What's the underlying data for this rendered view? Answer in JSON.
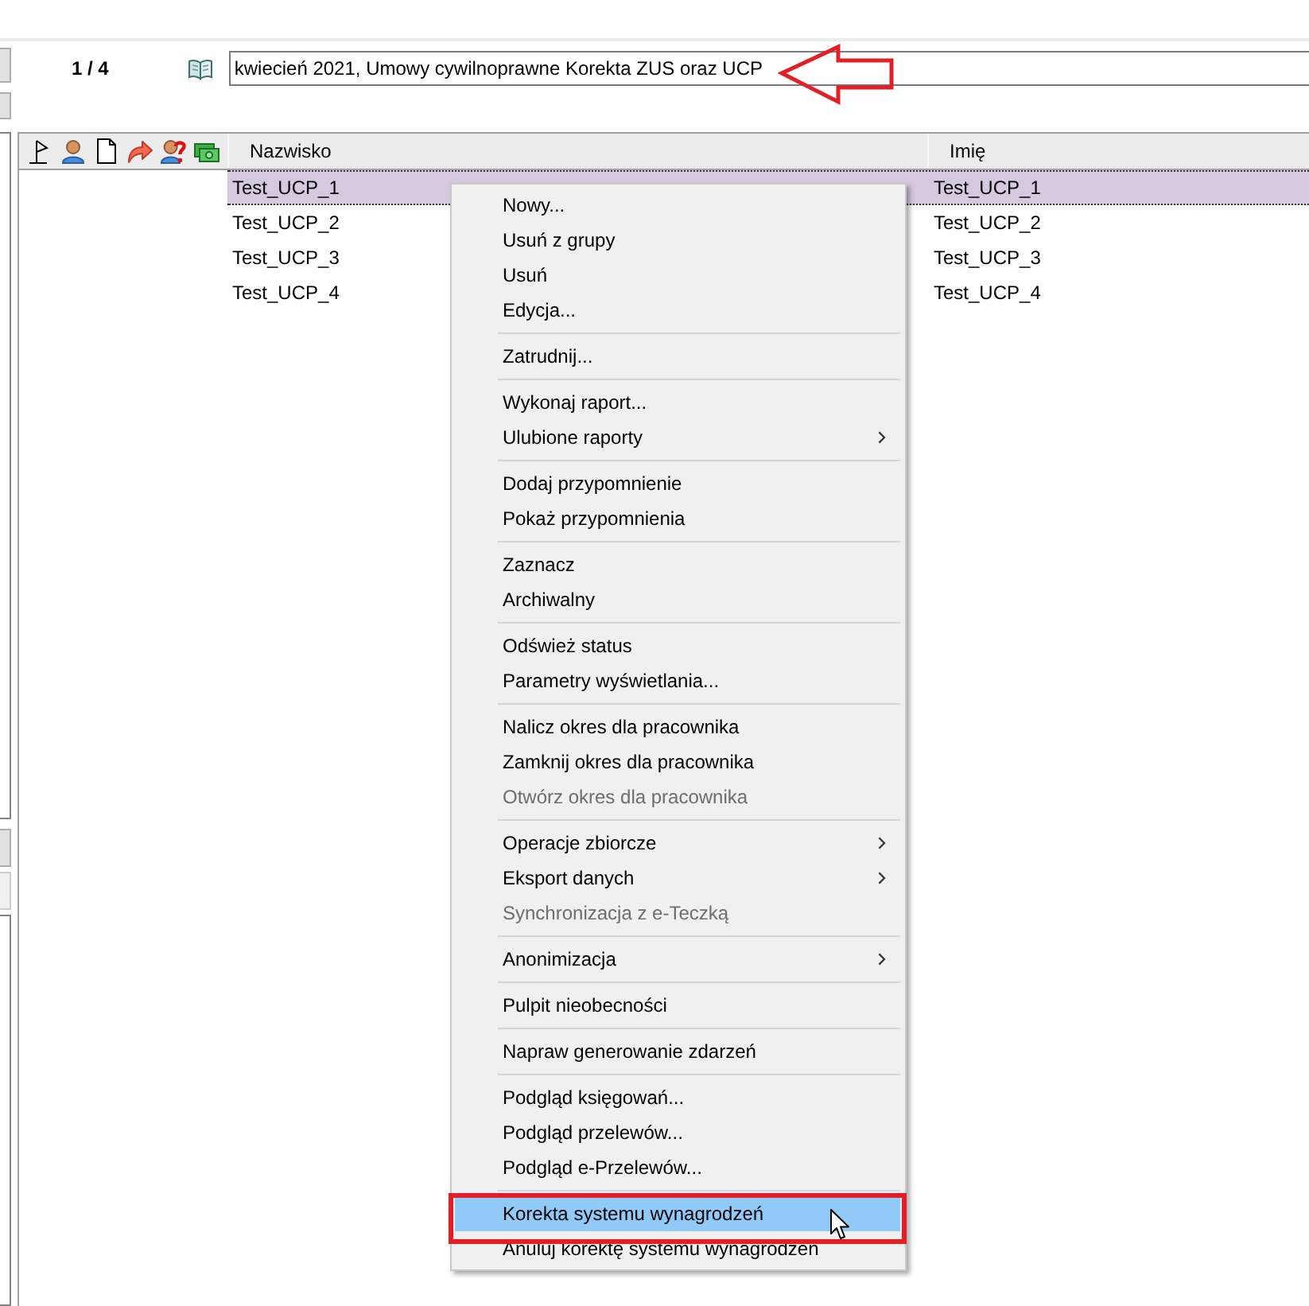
{
  "toolbar": {
    "record_counter": "1 / 4",
    "period_field": {
      "value": "kwiecień 2021, Umowy cywilnoprawne Korekta ZUS oraz UCP"
    }
  },
  "table": {
    "columns": [
      "Nazwisko",
      "Imię"
    ],
    "rows": [
      {
        "cells": [
          "Test_UCP_1",
          "Test_UCP_1"
        ],
        "selected": true
      },
      {
        "cells": [
          "Test_UCP_2",
          "Test_UCP_2"
        ],
        "selected": false
      },
      {
        "cells": [
          "Test_UCP_3",
          "Test_UCP_3"
        ],
        "selected": false
      },
      {
        "cells": [
          "Test_UCP_4",
          "Test_UCP_4"
        ],
        "selected": false
      }
    ]
  },
  "context_menu": {
    "groups": [
      {
        "items": [
          {
            "label": "Nowy...",
            "disabled": false,
            "submenu": false,
            "selected": false
          },
          {
            "label": "Usuń z grupy",
            "disabled": false,
            "submenu": false,
            "selected": false
          },
          {
            "label": "Usuń",
            "disabled": false,
            "submenu": false,
            "selected": false
          },
          {
            "label": "Edycja...",
            "disabled": false,
            "submenu": false,
            "selected": false
          }
        ]
      },
      {
        "items": [
          {
            "label": "Zatrudnij...",
            "disabled": false,
            "submenu": false,
            "selected": false
          }
        ]
      },
      {
        "items": [
          {
            "label": "Wykonaj raport...",
            "disabled": false,
            "submenu": false,
            "selected": false
          },
          {
            "label": "Ulubione raporty",
            "disabled": false,
            "submenu": true,
            "selected": false
          }
        ]
      },
      {
        "items": [
          {
            "label": "Dodaj przypomnienie",
            "disabled": false,
            "submenu": false,
            "selected": false
          },
          {
            "label": "Pokaż przypomnienia",
            "disabled": false,
            "submenu": false,
            "selected": false
          }
        ]
      },
      {
        "items": [
          {
            "label": "Zaznacz",
            "disabled": false,
            "submenu": false,
            "selected": false
          },
          {
            "label": "Archiwalny",
            "disabled": false,
            "submenu": false,
            "selected": false
          }
        ]
      },
      {
        "items": [
          {
            "label": "Odśwież status",
            "disabled": false,
            "submenu": false,
            "selected": false
          },
          {
            "label": "Parametry wyświetlania...",
            "disabled": false,
            "submenu": false,
            "selected": false
          }
        ]
      },
      {
        "items": [
          {
            "label": "Nalicz okres dla pracownika",
            "disabled": false,
            "submenu": false,
            "selected": false
          },
          {
            "label": "Zamknij okres dla pracownika",
            "disabled": false,
            "submenu": false,
            "selected": false
          },
          {
            "label": "Otwórz okres dla pracownika",
            "disabled": true,
            "submenu": false,
            "selected": false
          }
        ]
      },
      {
        "items": [
          {
            "label": "Operacje zbiorcze",
            "disabled": false,
            "submenu": true,
            "selected": false
          },
          {
            "label": "Eksport danych",
            "disabled": false,
            "submenu": true,
            "selected": false
          },
          {
            "label": "Synchronizacja z e-Teczką",
            "disabled": true,
            "submenu": false,
            "selected": false
          }
        ]
      },
      {
        "items": [
          {
            "label": "Anonimizacja",
            "disabled": false,
            "submenu": true,
            "selected": false
          }
        ]
      },
      {
        "items": [
          {
            "label": "Pulpit nieobecności",
            "disabled": false,
            "submenu": false,
            "selected": false
          }
        ]
      },
      {
        "items": [
          {
            "label": "Napraw generowanie zdarzeń",
            "disabled": false,
            "submenu": false,
            "selected": false
          }
        ]
      },
      {
        "items": [
          {
            "label": "Podgląd księgowań...",
            "disabled": false,
            "submenu": false,
            "selected": false
          },
          {
            "label": "Podgląd przelewów...",
            "disabled": false,
            "submenu": false,
            "selected": false
          },
          {
            "label": "Podgląd e-Przelewów...",
            "disabled": false,
            "submenu": false,
            "selected": false
          }
        ]
      },
      {
        "items": [
          {
            "label": "Korekta systemu wynagrodzeń",
            "disabled": false,
            "submenu": false,
            "selected": true
          },
          {
            "label": "Anuluj korektę systemu wynagrodzeń",
            "disabled": false,
            "submenu": false,
            "selected": false
          }
        ]
      }
    ]
  }
}
